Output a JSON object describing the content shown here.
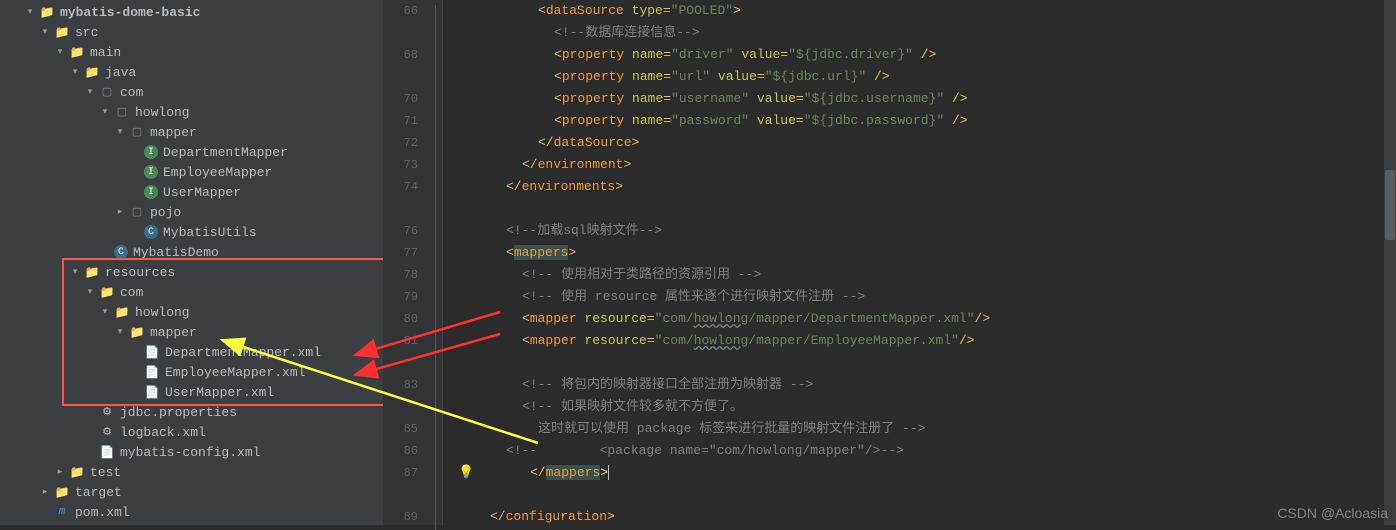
{
  "tree": [
    {
      "lvl": 0,
      "arr": "down",
      "ico": "folder",
      "txt": "mybatis-dome-basic",
      "bold": true
    },
    {
      "lvl": 1,
      "arr": "down",
      "ico": "folder",
      "txt": "src"
    },
    {
      "lvl": 2,
      "arr": "down",
      "ico": "folder",
      "txt": "main"
    },
    {
      "lvl": 3,
      "arr": "down",
      "ico": "folder",
      "txt": "java"
    },
    {
      "lvl": 4,
      "arr": "down",
      "ico": "pkg",
      "txt": "com"
    },
    {
      "lvl": 5,
      "arr": "down",
      "ico": "pkg",
      "txt": "howlong"
    },
    {
      "lvl": 6,
      "arr": "down",
      "ico": "pkg",
      "txt": "mapper"
    },
    {
      "lvl": 7,
      "arr": "",
      "ico": "interface",
      "txt": "DepartmentMapper"
    },
    {
      "lvl": 7,
      "arr": "",
      "ico": "interface",
      "txt": "EmployeeMapper"
    },
    {
      "lvl": 7,
      "arr": "",
      "ico": "interface",
      "txt": "UserMapper"
    },
    {
      "lvl": 6,
      "arr": "right",
      "ico": "pkg",
      "txt": "pojo"
    },
    {
      "lvl": 7,
      "arr": "",
      "ico": "class",
      "txt": "MybatisUtils"
    },
    {
      "lvl": 5,
      "arr": "",
      "ico": "class",
      "txt": "MybatisDemo"
    },
    {
      "lvl": 3,
      "arr": "down",
      "ico": "folder",
      "txt": "resources"
    },
    {
      "lvl": 4,
      "arr": "down",
      "ico": "folder",
      "txt": "com"
    },
    {
      "lvl": 5,
      "arr": "down",
      "ico": "folder",
      "txt": "howlong"
    },
    {
      "lvl": 6,
      "arr": "down",
      "ico": "folder",
      "txt": "mapper"
    },
    {
      "lvl": 7,
      "arr": "",
      "ico": "xml",
      "txt": "DepartmentMapper.xml"
    },
    {
      "lvl": 7,
      "arr": "",
      "ico": "xml",
      "txt": "EmployeeMapper.xml"
    },
    {
      "lvl": 7,
      "arr": "",
      "ico": "xml",
      "txt": "UserMapper.xml"
    },
    {
      "lvl": 4,
      "arr": "",
      "ico": "cfg",
      "txt": "jdbc.properties"
    },
    {
      "lvl": 4,
      "arr": "",
      "ico": "cfg",
      "txt": "logback.xml"
    },
    {
      "lvl": 4,
      "arr": "",
      "ico": "xml",
      "txt": "mybatis-config.xml"
    },
    {
      "lvl": 2,
      "arr": "right",
      "ico": "folder",
      "txt": "test"
    },
    {
      "lvl": 1,
      "arr": "right",
      "ico": "folder",
      "txt": "target"
    },
    {
      "lvl": 1,
      "arr": "",
      "ico": "pom",
      "txt": "pom.xml"
    }
  ],
  "lineNumbers": [
    "66",
    "",
    "68",
    "",
    "70",
    "71",
    "72",
    "73",
    "74",
    "",
    "76",
    "77",
    "78",
    "79",
    "80",
    "81",
    "",
    "83",
    "",
    "85",
    "86",
    "87",
    "",
    "89"
  ],
  "code": [
    {
      "type": "xml",
      "indent": 20,
      "parts": [
        {
          "c": "tag",
          "t": "<"
        },
        {
          "c": "tagname",
          "t": "dataSource"
        },
        {
          "c": "",
          "t": " "
        },
        {
          "c": "attr",
          "t": "type"
        },
        {
          "c": "tag",
          "t": "="
        },
        {
          "c": "str",
          "t": "\"POOLED\""
        },
        {
          "c": "tag",
          "t": ">"
        }
      ]
    },
    {
      "type": "cmt",
      "indent": 24,
      "parts": [
        {
          "c": "cmt",
          "t": "<!--数据库连接信息-->"
        }
      ]
    },
    {
      "type": "xml",
      "indent": 24,
      "parts": [
        {
          "c": "tag",
          "t": "<"
        },
        {
          "c": "tagname",
          "t": "property"
        },
        {
          "c": "",
          "t": " "
        },
        {
          "c": "attr",
          "t": "name"
        },
        {
          "c": "tag",
          "t": "="
        },
        {
          "c": "str",
          "t": "\"driver\""
        },
        {
          "c": "",
          "t": " "
        },
        {
          "c": "attr",
          "t": "value"
        },
        {
          "c": "tag",
          "t": "="
        },
        {
          "c": "str",
          "t": "\"${jdbc.driver}\""
        },
        {
          "c": "",
          "t": " "
        },
        {
          "c": "tag",
          "t": "/>"
        }
      ]
    },
    {
      "type": "xml",
      "indent": 24,
      "parts": [
        {
          "c": "tag",
          "t": "<"
        },
        {
          "c": "tagname",
          "t": "property"
        },
        {
          "c": "",
          "t": " "
        },
        {
          "c": "attr",
          "t": "name"
        },
        {
          "c": "tag",
          "t": "="
        },
        {
          "c": "str",
          "t": "\"url\""
        },
        {
          "c": "",
          "t": " "
        },
        {
          "c": "attr",
          "t": "value"
        },
        {
          "c": "tag",
          "t": "="
        },
        {
          "c": "str",
          "t": "\"${jdbc.url}\""
        },
        {
          "c": "",
          "t": " "
        },
        {
          "c": "tag",
          "t": "/>"
        }
      ]
    },
    {
      "type": "xml",
      "indent": 24,
      "parts": [
        {
          "c": "tag",
          "t": "<"
        },
        {
          "c": "tagname",
          "t": "property"
        },
        {
          "c": "",
          "t": " "
        },
        {
          "c": "attr",
          "t": "name"
        },
        {
          "c": "tag",
          "t": "="
        },
        {
          "c": "str",
          "t": "\"username\""
        },
        {
          "c": "",
          "t": " "
        },
        {
          "c": "attr",
          "t": "value"
        },
        {
          "c": "tag",
          "t": "="
        },
        {
          "c": "str",
          "t": "\"${jdbc.username}\""
        },
        {
          "c": "",
          "t": " "
        },
        {
          "c": "tag",
          "t": "/>"
        }
      ]
    },
    {
      "type": "xml",
      "indent": 24,
      "parts": [
        {
          "c": "tag",
          "t": "<"
        },
        {
          "c": "tagname",
          "t": "property"
        },
        {
          "c": "",
          "t": " "
        },
        {
          "c": "attr",
          "t": "name"
        },
        {
          "c": "tag",
          "t": "="
        },
        {
          "c": "str",
          "t": "\"password\""
        },
        {
          "c": "",
          "t": " "
        },
        {
          "c": "attr",
          "t": "value"
        },
        {
          "c": "tag",
          "t": "="
        },
        {
          "c": "str",
          "t": "\"${jdbc.password}\""
        },
        {
          "c": "",
          "t": " "
        },
        {
          "c": "tag",
          "t": "/>"
        }
      ]
    },
    {
      "type": "xml",
      "indent": 20,
      "parts": [
        {
          "c": "tag",
          "t": "</"
        },
        {
          "c": "tagname",
          "t": "dataSource"
        },
        {
          "c": "tag",
          "t": ">"
        }
      ]
    },
    {
      "type": "xml",
      "indent": 16,
      "parts": [
        {
          "c": "tag",
          "t": "</"
        },
        {
          "c": "tagname",
          "t": "environment"
        },
        {
          "c": "tag",
          "t": ">"
        }
      ]
    },
    {
      "type": "xml",
      "indent": 12,
      "parts": [
        {
          "c": "tag",
          "t": "</"
        },
        {
          "c": "tagname",
          "t": "environments"
        },
        {
          "c": "tag",
          "t": ">"
        }
      ]
    },
    {
      "type": "blank"
    },
    {
      "type": "cmt",
      "indent": 12,
      "parts": [
        {
          "c": "cmt",
          "t": "<!--加载sql映射文件-->"
        }
      ]
    },
    {
      "type": "xml",
      "indent": 12,
      "hl": true,
      "parts": [
        {
          "c": "tag",
          "t": "<"
        },
        {
          "c": "tagname",
          "t": "mappers",
          "hlXml": true
        },
        {
          "c": "tag",
          "t": ">"
        }
      ]
    },
    {
      "type": "cmt",
      "indent": 16,
      "parts": [
        {
          "c": "cmt",
          "t": "<!-- 使用相对于类路径的资源引用 -->"
        }
      ]
    },
    {
      "type": "cmt",
      "indent": 16,
      "parts": [
        {
          "c": "cmt",
          "t": "<!-- 使用 resource 属性来逐个进行映射文件注册 -->"
        }
      ]
    },
    {
      "type": "xml",
      "indent": 16,
      "parts": [
        {
          "c": "tag",
          "t": "<"
        },
        {
          "c": "tagname",
          "t": "mapper"
        },
        {
          "c": "",
          "t": " "
        },
        {
          "c": "attr",
          "t": "resource"
        },
        {
          "c": "tag",
          "t": "="
        },
        {
          "c": "str",
          "t": "\"com/"
        },
        {
          "c": "str wavy",
          "t": "howlong"
        },
        {
          "c": "str",
          "t": "/mapper/DepartmentMapper.xml\""
        },
        {
          "c": "tag",
          "t": "/>"
        }
      ]
    },
    {
      "type": "xml",
      "indent": 16,
      "parts": [
        {
          "c": "tag",
          "t": "<"
        },
        {
          "c": "tagname",
          "t": "mapper"
        },
        {
          "c": "",
          "t": " "
        },
        {
          "c": "attr",
          "t": "resource"
        },
        {
          "c": "tag",
          "t": "="
        },
        {
          "c": "str",
          "t": "\"com/"
        },
        {
          "c": "str wavy",
          "t": "howlong"
        },
        {
          "c": "str",
          "t": "/mapper/EmployeeMapper.xml\""
        },
        {
          "c": "tag",
          "t": "/>"
        }
      ]
    },
    {
      "type": "blank"
    },
    {
      "type": "cmt",
      "indent": 16,
      "parts": [
        {
          "c": "cmt",
          "t": "<!-- 将包内的映射器接口全部注册为映射器 -->"
        }
      ]
    },
    {
      "type": "cmt",
      "indent": 16,
      "parts": [
        {
          "c": "cmt",
          "t": "<!-- 如果映射文件较多就不方便了。"
        }
      ]
    },
    {
      "type": "cmt",
      "indent": 20,
      "parts": [
        {
          "c": "cmt",
          "t": "这时就可以使用 package 标签来进行批量的映射文件注册了 -->"
        }
      ]
    },
    {
      "type": "cmt",
      "indent": 12,
      "parts": [
        {
          "c": "cmt",
          "t": "<!--        <package name=\"com/howlong/mapper\"/>-->"
        }
      ]
    },
    {
      "type": "xml",
      "indent": 12,
      "cursor": true,
      "bulb": true,
      "parts": [
        {
          "c": "tag",
          "t": "</"
        },
        {
          "c": "tagname",
          "t": "mappers",
          "hlXml": true
        },
        {
          "c": "bright-brace",
          "t": ">"
        }
      ]
    },
    {
      "type": "blank"
    },
    {
      "type": "xml",
      "indent": 8,
      "parts": [
        {
          "c": "tag",
          "t": "</"
        },
        {
          "c": "tagname",
          "t": "configuration"
        },
        {
          "c": "tag",
          "t": ">"
        }
      ]
    }
  ],
  "watermark": "CSDN @Acloasia"
}
